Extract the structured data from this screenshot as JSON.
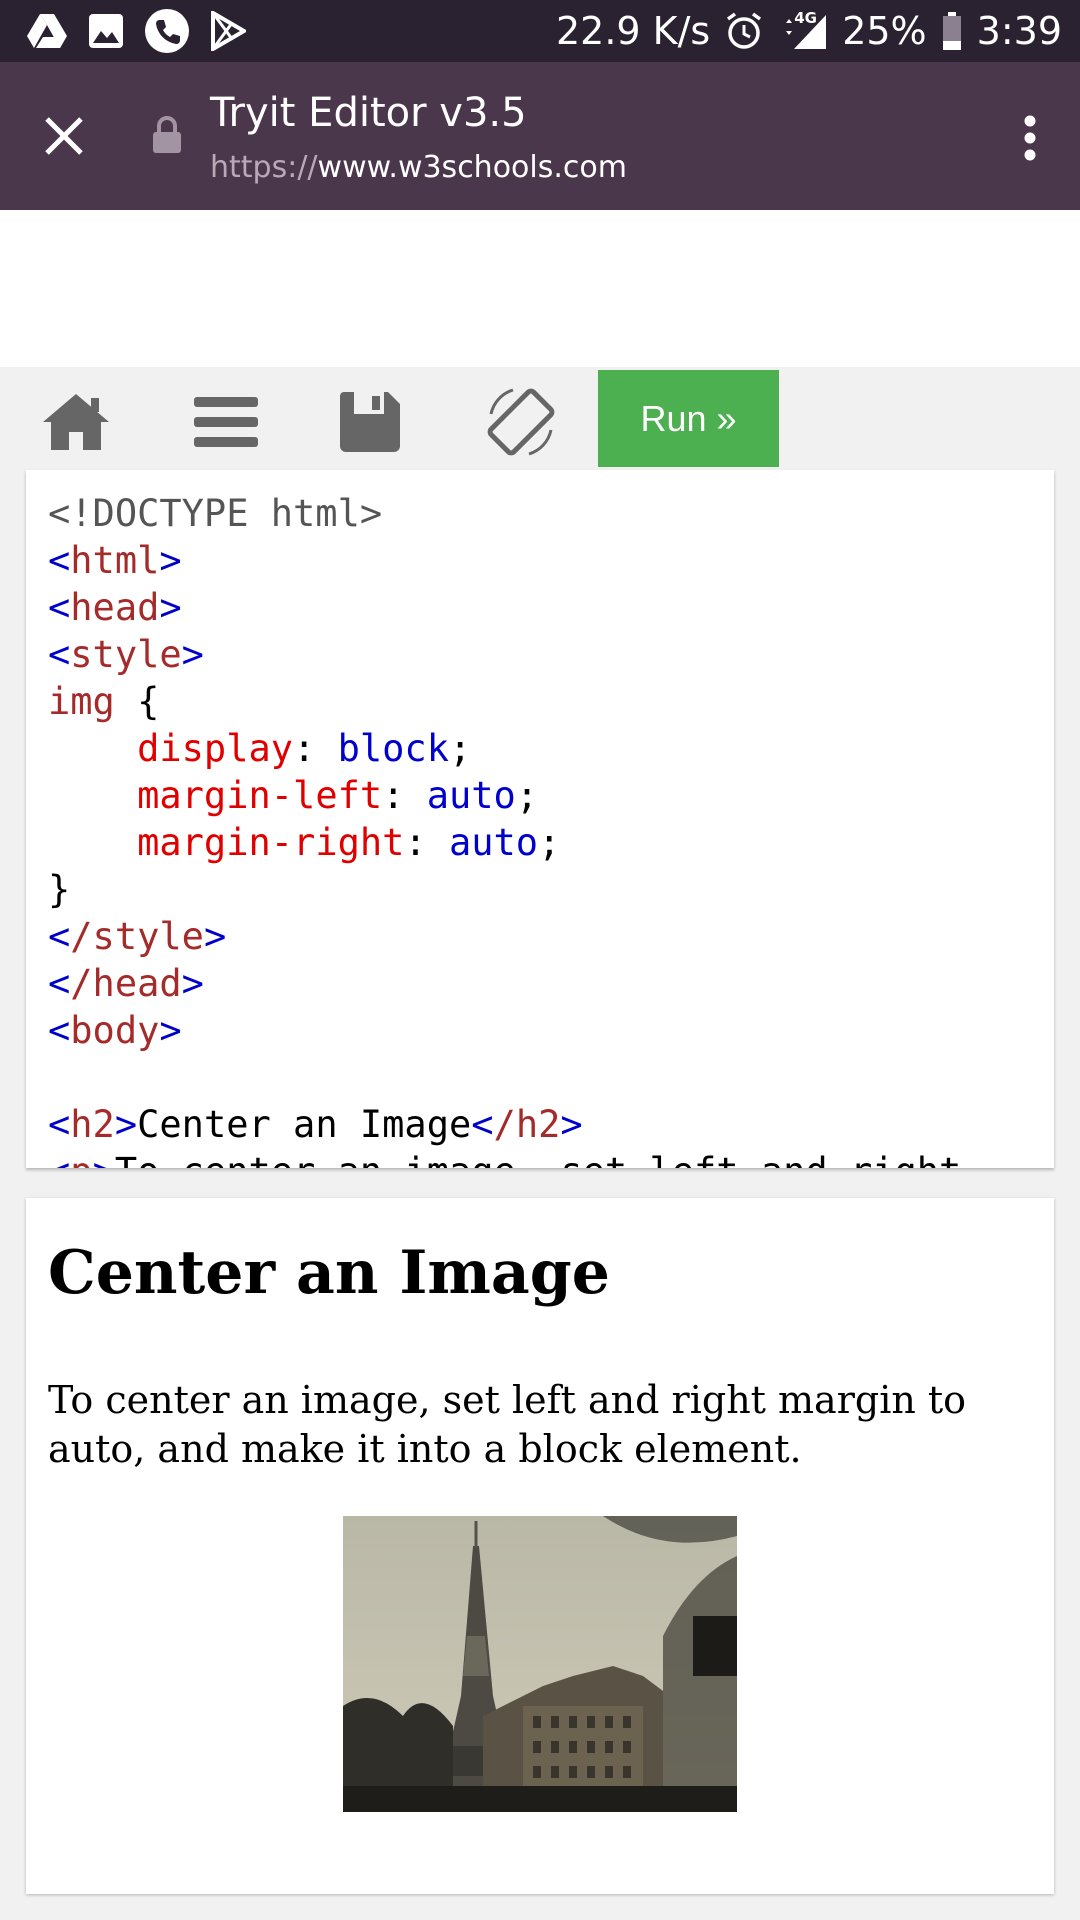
{
  "status_bar": {
    "net_speed": "22.9 K/s",
    "network": "4G",
    "battery": "25%",
    "time": "3:39",
    "left_icons": [
      "drive-icon",
      "gallery-icon",
      "phone-icon",
      "play-store-icon"
    ]
  },
  "header": {
    "title": "Tryit Editor v3.5",
    "url_scheme": "https://",
    "url_host": "www.w3schools.com"
  },
  "toolbar": {
    "run_label": "Run »"
  },
  "code": {
    "doctype": "<!DOCTYPE html>",
    "html_open_tag": "html",
    "head_open_tag": "head",
    "style_open_tag": "style",
    "selector": "img",
    "open_brace": " {",
    "prop1": "display",
    "val1": "block",
    "prop2": "margin-left",
    "val2": "auto",
    "prop3": "margin-right",
    "val3": "auto",
    "close_brace": "}",
    "style_close_tag": "/style",
    "head_close_tag": "/head",
    "body_open_tag": "body",
    "h2_tag": "h2",
    "h2_text": "Center an Image",
    "h2_close_tag": "/h2",
    "p_tag": "p",
    "p_text": "To center an image, set left and right"
  },
  "result": {
    "heading": "Center an Image",
    "paragraph": "To center an image, set left and right margin to auto, and make it into a block element."
  }
}
